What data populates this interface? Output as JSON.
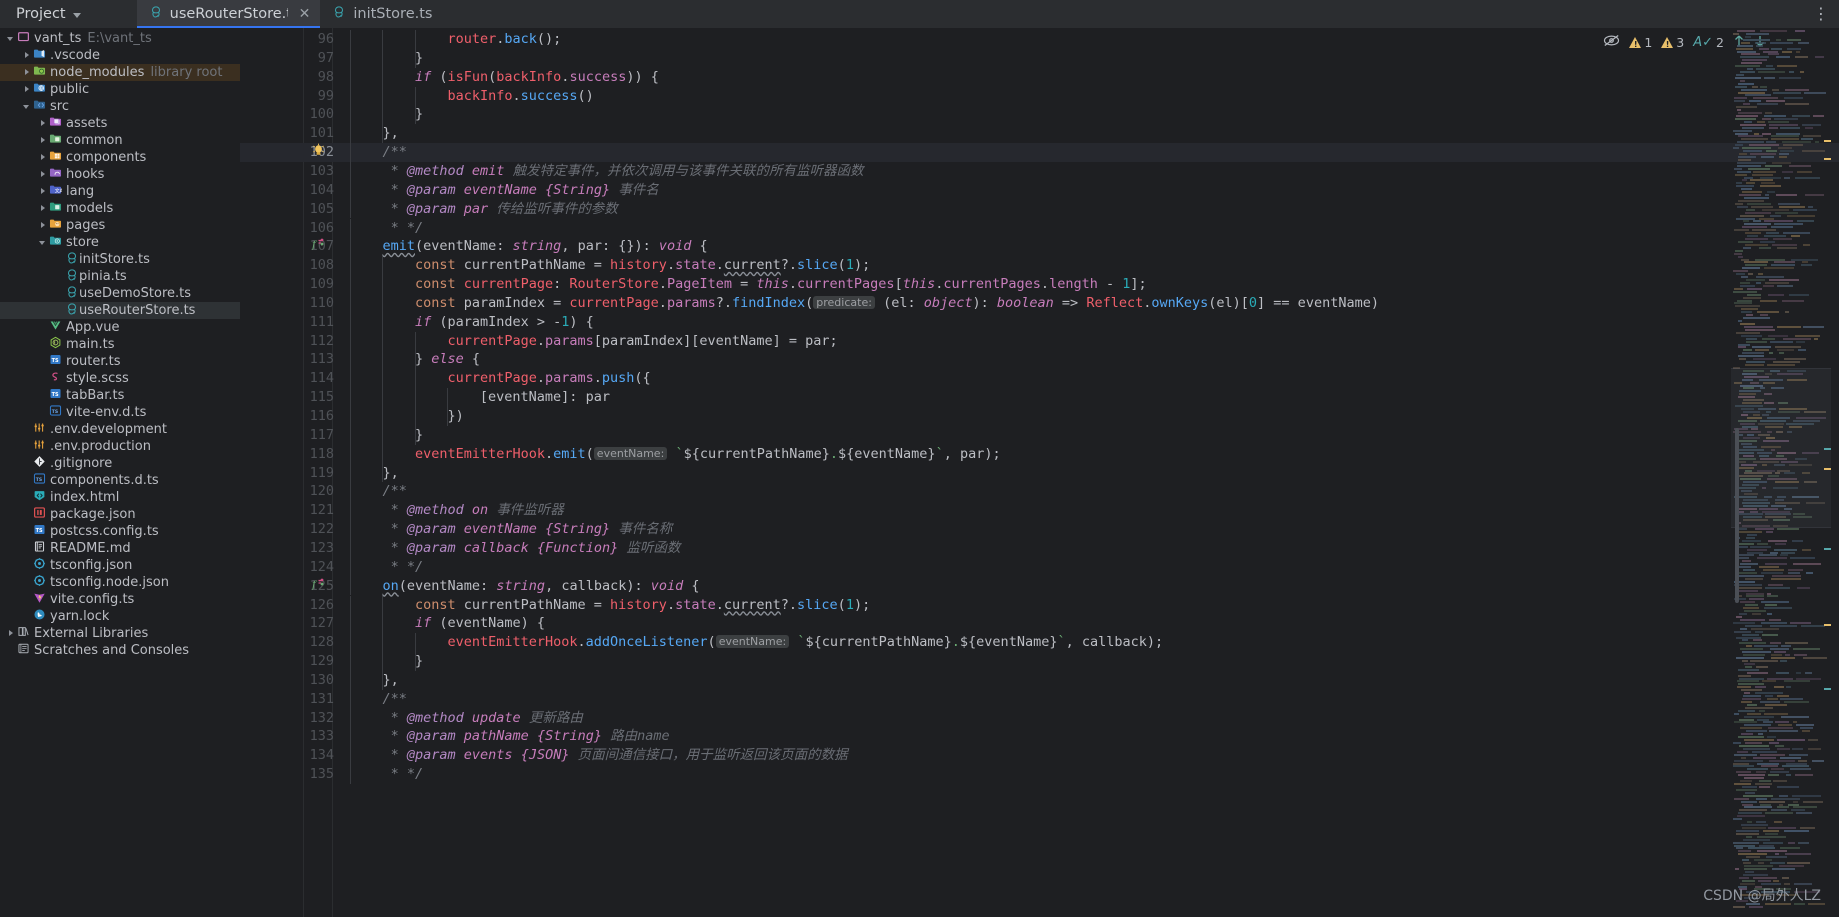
{
  "window": {
    "project_button": "Project",
    "kebab_label": "⋮"
  },
  "tabs": [
    {
      "label": "useRouterStore.ts",
      "icon": "pinia-store-icon",
      "active": true,
      "closable": true
    },
    {
      "label": "initStore.ts",
      "icon": "pinia-store-icon",
      "active": false,
      "closable": false
    }
  ],
  "project_tree": [
    {
      "indent": 0,
      "arrow": "down",
      "icon": "folder-module-icon",
      "label": "vant_ts",
      "hint": "E:\\vant_ts",
      "state": "none"
    },
    {
      "indent": 1,
      "arrow": "right",
      "icon": "folder-vscode-icon",
      "label": ".vscode",
      "hint": "",
      "state": "none"
    },
    {
      "indent": 1,
      "arrow": "right",
      "icon": "folder-node-icon",
      "label": "node_modules",
      "hint": "library root",
      "state": "library"
    },
    {
      "indent": 1,
      "arrow": "right",
      "icon": "folder-public-icon",
      "label": "public",
      "hint": "",
      "state": "none"
    },
    {
      "indent": 1,
      "arrow": "down",
      "icon": "folder-source-icon",
      "label": "src",
      "hint": "",
      "state": "none"
    },
    {
      "indent": 2,
      "arrow": "right",
      "icon": "folder-assets-icon",
      "label": "assets",
      "hint": "",
      "state": "none"
    },
    {
      "indent": 2,
      "arrow": "right",
      "icon": "folder-common-icon",
      "label": "common",
      "hint": "",
      "state": "none"
    },
    {
      "indent": 2,
      "arrow": "right",
      "icon": "folder-components-icon",
      "label": "components",
      "hint": "",
      "state": "none"
    },
    {
      "indent": 2,
      "arrow": "right",
      "icon": "folder-hooks-icon",
      "label": "hooks",
      "hint": "",
      "state": "none"
    },
    {
      "indent": 2,
      "arrow": "right",
      "icon": "folder-lang-icon",
      "label": "lang",
      "hint": "",
      "state": "none"
    },
    {
      "indent": 2,
      "arrow": "right",
      "icon": "folder-models-icon",
      "label": "models",
      "hint": "",
      "state": "none"
    },
    {
      "indent": 2,
      "arrow": "right",
      "icon": "folder-pages-icon",
      "label": "pages",
      "hint": "",
      "state": "none"
    },
    {
      "indent": 2,
      "arrow": "down",
      "icon": "folder-store-icon",
      "label": "store",
      "hint": "",
      "state": "none"
    },
    {
      "indent": 3,
      "arrow": "none",
      "icon": "pinia-store-icon",
      "label": "initStore.ts",
      "hint": "",
      "state": "none"
    },
    {
      "indent": 3,
      "arrow": "none",
      "icon": "pinia-store-icon",
      "label": "pinia.ts",
      "hint": "",
      "state": "none"
    },
    {
      "indent": 3,
      "arrow": "none",
      "icon": "pinia-store-icon",
      "label": "useDemoStore.ts",
      "hint": "",
      "state": "none"
    },
    {
      "indent": 3,
      "arrow": "none",
      "icon": "pinia-store-icon",
      "label": "useRouterStore.ts",
      "hint": "",
      "state": "selected"
    },
    {
      "indent": 2,
      "arrow": "none",
      "icon": "vue-file-icon",
      "label": "App.vue",
      "hint": "",
      "state": "none"
    },
    {
      "indent": 2,
      "arrow": "none",
      "icon": "js-node-icon",
      "label": "main.ts",
      "hint": "",
      "state": "none"
    },
    {
      "indent": 2,
      "arrow": "none",
      "icon": "ts-file-icon",
      "label": "router.ts",
      "hint": "",
      "state": "none"
    },
    {
      "indent": 2,
      "arrow": "none",
      "icon": "scss-file-icon",
      "label": "style.scss",
      "hint": "",
      "state": "none"
    },
    {
      "indent": 2,
      "arrow": "none",
      "icon": "ts-file-icon",
      "label": "tabBar.ts",
      "hint": "",
      "state": "none"
    },
    {
      "indent": 2,
      "arrow": "none",
      "icon": "ts-dts-file-icon",
      "label": "vite-env.d.ts",
      "hint": "",
      "state": "none"
    },
    {
      "indent": 1,
      "arrow": "none",
      "icon": "env-file-icon",
      "label": ".env.development",
      "hint": "",
      "state": "none"
    },
    {
      "indent": 1,
      "arrow": "none",
      "icon": "env-file-icon",
      "label": ".env.production",
      "hint": "",
      "state": "none"
    },
    {
      "indent": 1,
      "arrow": "none",
      "icon": "git-file-icon",
      "label": ".gitignore",
      "hint": "",
      "state": "none"
    },
    {
      "indent": 1,
      "arrow": "none",
      "icon": "ts-dts-file-icon",
      "label": "components.d.ts",
      "hint": "",
      "state": "none"
    },
    {
      "indent": 1,
      "arrow": "none",
      "icon": "html-file-icon",
      "label": "index.html",
      "hint": "",
      "state": "none"
    },
    {
      "indent": 1,
      "arrow": "none",
      "icon": "json-pkg-icon",
      "label": "package.json",
      "hint": "",
      "state": "none"
    },
    {
      "indent": 1,
      "arrow": "none",
      "icon": "ts-file-icon",
      "label": "postcss.config.ts",
      "hint": "",
      "state": "none"
    },
    {
      "indent": 1,
      "arrow": "none",
      "icon": "readme-file-icon",
      "label": "README.md",
      "hint": "",
      "state": "none"
    },
    {
      "indent": 1,
      "arrow": "none",
      "icon": "tsconfig-file-icon",
      "label": "tsconfig.json",
      "hint": "",
      "state": "none"
    },
    {
      "indent": 1,
      "arrow": "none",
      "icon": "tsconfig-file-icon",
      "label": "tsconfig.node.json",
      "hint": "",
      "state": "none"
    },
    {
      "indent": 1,
      "arrow": "none",
      "icon": "vite-file-icon",
      "label": "vite.config.ts",
      "hint": "",
      "state": "none"
    },
    {
      "indent": 1,
      "arrow": "none",
      "icon": "yarn-lock-icon",
      "label": "yarn.lock",
      "hint": "",
      "state": "none"
    },
    {
      "indent": 0,
      "arrow": "right",
      "icon": "external-libs-icon",
      "label": "External Libraries",
      "hint": "",
      "state": "none"
    },
    {
      "indent": 0,
      "arrow": "none",
      "icon": "scratches-icon",
      "label": "Scratches and Consoles",
      "hint": "",
      "state": "none"
    }
  ],
  "inspection_widget": {
    "no_highlight_icon": "crossed-eye-icon",
    "items": [
      {
        "icon": "warning-triangle-icon",
        "count": "1"
      },
      {
        "icon": "warning-triangle-icon",
        "count": "3"
      },
      {
        "icon": "spellcheck-icon",
        "count": "2"
      }
    ],
    "prev_icon": "arrow-up-icon",
    "next_icon": "arrow-down-icon"
  },
  "editor": {
    "first_line": 96,
    "caret_line": 102,
    "lines": [
      {
        "n": 96,
        "indent": 3,
        "guides": 3,
        "text": "router.back();"
      },
      {
        "n": 97,
        "indent": 2,
        "guides": 3,
        "text": "}"
      },
      {
        "n": 98,
        "indent": 2,
        "guides": 2,
        "text": "if (isFun(backInfo.success)) {"
      },
      {
        "n": 99,
        "indent": 3,
        "guides": 3,
        "text": "backInfo.success()"
      },
      {
        "n": 100,
        "indent": 2,
        "guides": 3,
        "text": "}"
      },
      {
        "n": 101,
        "indent": 1,
        "guides": 2,
        "text": "},"
      },
      {
        "n": 102,
        "indent": 1,
        "guides": 1,
        "text": "/**"
      },
      {
        "n": 103,
        "indent": 1,
        "guides": 1,
        "text": " * @method emit 触发特定事件，并依次调用与该事件关联的所有监听器函数"
      },
      {
        "n": 104,
        "indent": 1,
        "guides": 1,
        "text": " * @param eventName {String} 事件名"
      },
      {
        "n": 105,
        "indent": 1,
        "guides": 1,
        "text": " * @param par 传给监听事件的参数"
      },
      {
        "n": 106,
        "indent": 1,
        "guides": 1,
        "text": " * */"
      },
      {
        "n": 107,
        "indent": 1,
        "guides": 1,
        "text": "emit(eventName: string, par: {}): void {"
      },
      {
        "n": 108,
        "indent": 2,
        "guides": 2,
        "text": "const currentPathName = history.state.current?.slice(1);"
      },
      {
        "n": 109,
        "indent": 2,
        "guides": 2,
        "text": "const currentPage: RouterStore.PageItem = this.currentPages[this.currentPages.length - 1];"
      },
      {
        "n": 110,
        "indent": 2,
        "guides": 2,
        "text": "const paramIndex = currentPage.params?.findIndex( predicate: (el: object): boolean => Reflect.ownKeys(el)[0] == eventName)"
      },
      {
        "n": 111,
        "indent": 2,
        "guides": 2,
        "text": "if (paramIndex > -1) {"
      },
      {
        "n": 112,
        "indent": 3,
        "guides": 3,
        "text": "currentPage.params[paramIndex][eventName] = par;"
      },
      {
        "n": 113,
        "indent": 2,
        "guides": 3,
        "text": "} else {"
      },
      {
        "n": 114,
        "indent": 3,
        "guides": 3,
        "text": "currentPage.params.push({"
      },
      {
        "n": 115,
        "indent": 4,
        "guides": 4,
        "text": "[eventName]: par"
      },
      {
        "n": 116,
        "indent": 3,
        "guides": 4,
        "text": "})"
      },
      {
        "n": 117,
        "indent": 2,
        "guides": 3,
        "text": "}"
      },
      {
        "n": 118,
        "indent": 2,
        "guides": 2,
        "text": "eventEmitterHook.emit( eventName: `${currentPathName}.${eventName}`, par);"
      },
      {
        "n": 119,
        "indent": 1,
        "guides": 2,
        "text": "},"
      },
      {
        "n": 120,
        "indent": 1,
        "guides": 1,
        "text": "/**"
      },
      {
        "n": 121,
        "indent": 1,
        "guides": 1,
        "text": " * @method on 事件监听器"
      },
      {
        "n": 122,
        "indent": 1,
        "guides": 1,
        "text": " * @param eventName {String} 事件名称"
      },
      {
        "n": 123,
        "indent": 1,
        "guides": 1,
        "text": " * @param callback {Function} 监听函数"
      },
      {
        "n": 124,
        "indent": 1,
        "guides": 1,
        "text": " * */"
      },
      {
        "n": 125,
        "indent": 1,
        "guides": 1,
        "text": "on(eventName: string, callback): void {"
      },
      {
        "n": 126,
        "indent": 2,
        "guides": 2,
        "text": "const currentPathName = history.state.current?.slice(1);"
      },
      {
        "n": 127,
        "indent": 2,
        "guides": 2,
        "text": "if (eventName) {"
      },
      {
        "n": 128,
        "indent": 3,
        "guides": 3,
        "text": "eventEmitterHook.addOnceListener( eventName: `${currentPathName}.${eventName}`, callback);"
      },
      {
        "n": 129,
        "indent": 2,
        "guides": 3,
        "text": "}"
      },
      {
        "n": 130,
        "indent": 1,
        "guides": 2,
        "text": "},"
      },
      {
        "n": 131,
        "indent": 1,
        "guides": 1,
        "text": "/**"
      },
      {
        "n": 132,
        "indent": 1,
        "guides": 1,
        "text": " * @method update 更新路由"
      },
      {
        "n": 133,
        "indent": 1,
        "guides": 1,
        "text": " * @param pathName {String} 路由name"
      },
      {
        "n": 134,
        "indent": 1,
        "guides": 1,
        "text": " * @param events {JSON} 页面间通信接口，用于监听返回该页面的数据"
      },
      {
        "n": 135,
        "indent": 1,
        "guides": 1,
        "text": " * */"
      }
    ],
    "gutter_markers": [
      {
        "line": 102,
        "icon": "intention-bulb-icon"
      },
      {
        "line": 107,
        "icon": "method-override-icon"
      },
      {
        "line": 125,
        "icon": "method-override-icon"
      }
    ]
  },
  "watermark": "CSDN @局外人LZ",
  "colors": {
    "background": "#1e1f22",
    "toolbar": "#2b2d30",
    "active_tab": "#393b40",
    "tab_underline": "#3574f0",
    "selection": "#2e3235",
    "library_row": "#3b2f20",
    "caret_line": "#26282e",
    "warning": "#e8bf6a",
    "spellcheck": "#57a8ab"
  }
}
